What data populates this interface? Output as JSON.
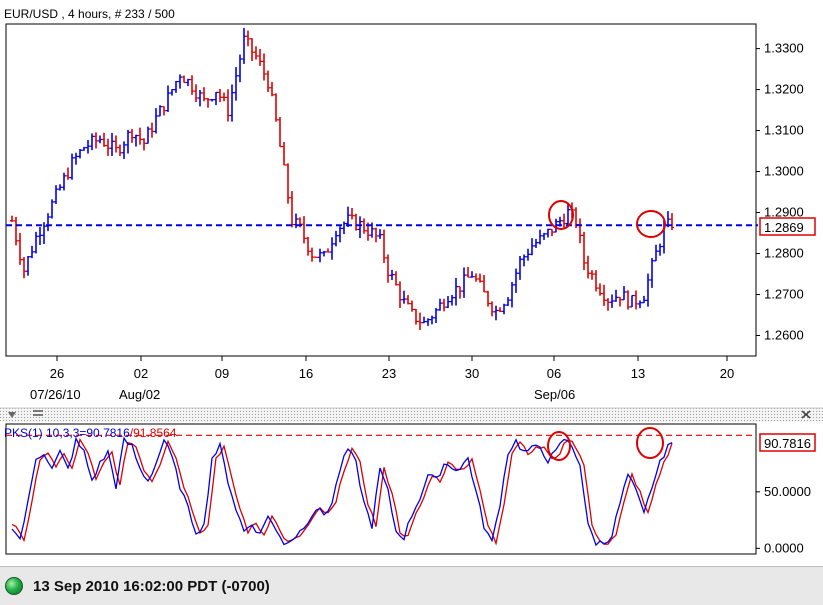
{
  "chart_data": [
    {
      "type": "ohlc",
      "title": "EUR/USD , 4 hours, # 233 / 500",
      "x_tick_labels": [
        "26",
        "02",
        "09",
        "16",
        "23",
        "30",
        "06",
        "13",
        "20"
      ],
      "x_sub_labels": [
        "07/26/10",
        "Aug/02",
        "Sep/06"
      ],
      "ylim": [
        1.255,
        1.336
      ],
      "y_ticks": [
        "1.3300",
        "1.3200",
        "1.3100",
        "1.3000",
        "1.2900",
        "1.2800",
        "1.2700",
        "1.2600"
      ],
      "last_price_label": "1.2869",
      "last_price": 1.2869,
      "bar_color_up": "#0000ee",
      "bar_color_down": "#dd0000",
      "close_path": [
        [
          0,
          1.288
        ],
        [
          3,
          1.276
        ],
        [
          6,
          1.284
        ],
        [
          9,
          1.29
        ],
        [
          12,
          1.296
        ],
        [
          15,
          1.302
        ],
        [
          18,
          1.306
        ],
        [
          22,
          1.308
        ],
        [
          26,
          1.305
        ],
        [
          30,
          1.31
        ],
        [
          33,
          1.307
        ],
        [
          36,
          1.313
        ],
        [
          39,
          1.318
        ],
        [
          42,
          1.324
        ],
        [
          45,
          1.321
        ],
        [
          48,
          1.317
        ],
        [
          51,
          1.32
        ],
        [
          54,
          1.315
        ],
        [
          58,
          1.332
        ],
        [
          61,
          1.328
        ],
        [
          64,
          1.322
        ],
        [
          66,
          1.312
        ],
        [
          68,
          1.3
        ],
        [
          70,
          1.288
        ],
        [
          72,
          1.286
        ],
        [
          75,
          1.28
        ],
        [
          78,
          1.279
        ],
        [
          81,
          1.286
        ],
        [
          84,
          1.288
        ],
        [
          87,
          1.287
        ],
        [
          90,
          1.285
        ],
        [
          92,
          1.283
        ],
        [
          94,
          1.276
        ],
        [
          96,
          1.272
        ],
        [
          98,
          1.268
        ],
        [
          100,
          1.265
        ],
        [
          103,
          1.263
        ],
        [
          106,
          1.266
        ],
        [
          109,
          1.27
        ],
        [
          112,
          1.272
        ],
        [
          115,
          1.275
        ],
        [
          118,
          1.27
        ],
        [
          121,
          1.266
        ],
        [
          124,
          1.27
        ],
        [
          127,
          1.278
        ],
        [
          130,
          1.282
        ],
        [
          133,
          1.284
        ],
        [
          136,
          1.287
        ],
        [
          139,
          1.29
        ],
        [
          141,
          1.288
        ],
        [
          143,
          1.278
        ],
        [
          146,
          1.273
        ],
        [
          149,
          1.269
        ],
        [
          152,
          1.27
        ],
        [
          155,
          1.268
        ],
        [
          158,
          1.27
        ],
        [
          161,
          1.28
        ],
        [
          163,
          1.286
        ],
        [
          165,
          1.2875
        ]
      ],
      "bar_count": 166,
      "horizontal_line": 1.2869,
      "grid": false
    },
    {
      "type": "line",
      "title": "PKS(1) 10,3,3=90.7816/91.8564",
      "title_part_a": "PKS(1) 10,3,3=90.7816",
      "title_part_b": "/91.8564",
      "ylim": [
        -5,
        110
      ],
      "y_ticks": [
        "50.0000",
        "0.0000"
      ],
      "last_value_label": "90.7816",
      "reference_line": 100,
      "series": [
        {
          "name": "90.7816",
          "color": "#0000ee"
        },
        {
          "name": "91.8564",
          "color": "#dd0000"
        }
      ],
      "osc_path": [
        [
          0,
          20
        ],
        [
          2,
          8
        ],
        [
          4,
          40
        ],
        [
          6,
          80
        ],
        [
          8,
          85
        ],
        [
          10,
          70
        ],
        [
          12,
          85
        ],
        [
          14,
          70
        ],
        [
          16,
          95
        ],
        [
          18,
          85
        ],
        [
          20,
          60
        ],
        [
          22,
          75
        ],
        [
          24,
          85
        ],
        [
          26,
          55
        ],
        [
          28,
          95
        ],
        [
          30,
          90
        ],
        [
          32,
          70
        ],
        [
          34,
          60
        ],
        [
          36,
          75
        ],
        [
          38,
          96
        ],
        [
          40,
          80
        ],
        [
          42,
          55
        ],
        [
          44,
          35
        ],
        [
          46,
          15
        ],
        [
          48,
          20
        ],
        [
          50,
          80
        ],
        [
          52,
          90
        ],
        [
          54,
          60
        ],
        [
          56,
          35
        ],
        [
          58,
          15
        ],
        [
          60,
          22
        ],
        [
          62,
          12
        ],
        [
          64,
          30
        ],
        [
          66,
          15
        ],
        [
          68,
          5
        ],
        [
          70,
          8
        ],
        [
          72,
          15
        ],
        [
          74,
          25
        ],
        [
          76,
          35
        ],
        [
          78,
          30
        ],
        [
          80,
          40
        ],
        [
          82,
          70
        ],
        [
          84,
          88
        ],
        [
          86,
          75
        ],
        [
          88,
          40
        ],
        [
          90,
          20
        ],
        [
          92,
          70
        ],
        [
          94,
          50
        ],
        [
          96,
          15
        ],
        [
          98,
          10
        ],
        [
          100,
          30
        ],
        [
          102,
          45
        ],
        [
          104,
          65
        ],
        [
          106,
          60
        ],
        [
          108,
          75
        ],
        [
          110,
          72
        ],
        [
          112,
          70
        ],
        [
          114,
          80
        ],
        [
          116,
          50
        ],
        [
          118,
          20
        ],
        [
          120,
          5
        ],
        [
          122,
          40
        ],
        [
          124,
          85
        ],
        [
          126,
          95
        ],
        [
          128,
          85
        ],
        [
          130,
          88
        ],
        [
          132,
          90
        ],
        [
          134,
          78
        ],
        [
          136,
          85
        ],
        [
          138,
          97
        ],
        [
          140,
          90
        ],
        [
          142,
          75
        ],
        [
          144,
          20
        ],
        [
          146,
          5
        ],
        [
          148,
          5
        ],
        [
          150,
          12
        ],
        [
          152,
          40
        ],
        [
          154,
          65
        ],
        [
          156,
          50
        ],
        [
          158,
          30
        ],
        [
          160,
          55
        ],
        [
          162,
          75
        ],
        [
          164,
          92
        ],
        [
          165,
          91
        ]
      ],
      "grid": false
    }
  ],
  "status": {
    "datetime": "13 Sep 2010 16:02:00 PDT (-0700)",
    "indicator_color": "#23b04a"
  },
  "annotations": {
    "circle_color": "#dd0000"
  }
}
